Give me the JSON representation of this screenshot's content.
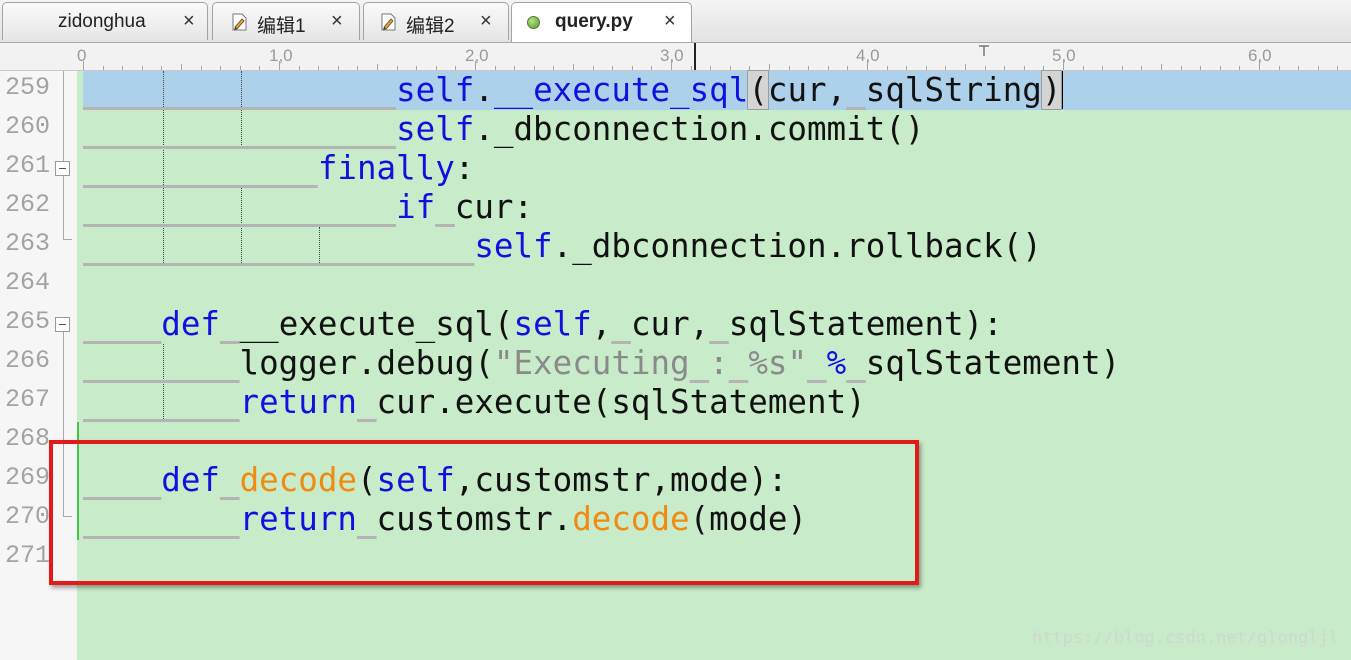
{
  "tabs": [
    {
      "label": "zidonghua",
      "icon": "none",
      "active": false
    },
    {
      "label": "编辑1",
      "icon": "document-pencil-icon",
      "active": false
    },
    {
      "label": "编辑2",
      "icon": "document-pencil-icon",
      "active": false
    },
    {
      "label": "query.py",
      "icon": "green-dot-icon",
      "active": true
    }
  ],
  "tab_close_glyph": "×",
  "ruler": {
    "labels": [
      "0",
      "1,0",
      "2,0",
      "3,0",
      "4,0",
      "5,0",
      "6,0"
    ]
  },
  "code": {
    "first_line_number": 259,
    "current_line": 259,
    "lines": [
      {
        "num": "259",
        "text": "                self.__execute_sql(cur, sqlString)"
      },
      {
        "num": "260",
        "text": "                self._dbconnection.commit()"
      },
      {
        "num": "261",
        "text": "            finally:"
      },
      {
        "num": "262",
        "text": "                if cur:"
      },
      {
        "num": "263",
        "text": "                    self._dbconnection.rollback()"
      },
      {
        "num": "264",
        "text": ""
      },
      {
        "num": "265",
        "text": "    def __execute_sql(self, cur, sqlStatement):"
      },
      {
        "num": "266",
        "text": "        logger.debug(\"Executing : %s\" % sqlStatement)"
      },
      {
        "num": "267",
        "text": "        return cur.execute(sqlStatement)"
      },
      {
        "num": "268",
        "text": ""
      },
      {
        "num": "269",
        "text": "    def decode(self,customstr,mode):"
      },
      {
        "num": "270",
        "text": "        return customstr.decode(mode)"
      },
      {
        "num": "271",
        "text": ""
      }
    ]
  },
  "colors": {
    "background": "#c8ebc9",
    "current_line": "#add1ea",
    "keyword": "#1010e0",
    "function_name": "#f08a10",
    "string": "#8a8a8a",
    "annotation_box": "#e21a1a"
  },
  "watermark": "https://blog.csdn.net/glongljl"
}
